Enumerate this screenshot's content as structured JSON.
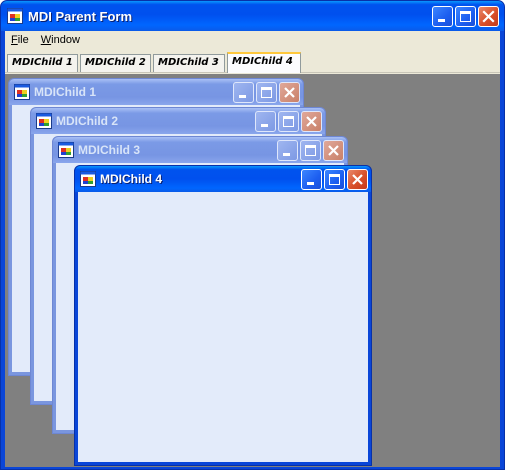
{
  "window": {
    "title": "MDI Parent Form",
    "icon": "app-form-icon"
  },
  "menu": {
    "items": [
      {
        "label_accel": "F",
        "label_rest": "ile"
      },
      {
        "label_accel": "W",
        "label_rest": "indow"
      }
    ]
  },
  "tabs": [
    {
      "label": "MDIChild 1",
      "active": false
    },
    {
      "label": "MDIChild 2",
      "active": false
    },
    {
      "label": "MDIChild 3",
      "active": false
    },
    {
      "label": "MDIChild 4",
      "active": true
    }
  ],
  "children": [
    {
      "title": "MDIChild 1",
      "active": false
    },
    {
      "title": "MDIChild 2",
      "active": false
    },
    {
      "title": "MDIChild 3",
      "active": false
    },
    {
      "title": "MDIChild 4",
      "active": true
    }
  ],
  "colors": {
    "titlebar_active": "#0050ee",
    "titlebar_inactive": "#7b9ae6",
    "mdi_background": "#808080",
    "child_client": "#e3ebfa"
  }
}
